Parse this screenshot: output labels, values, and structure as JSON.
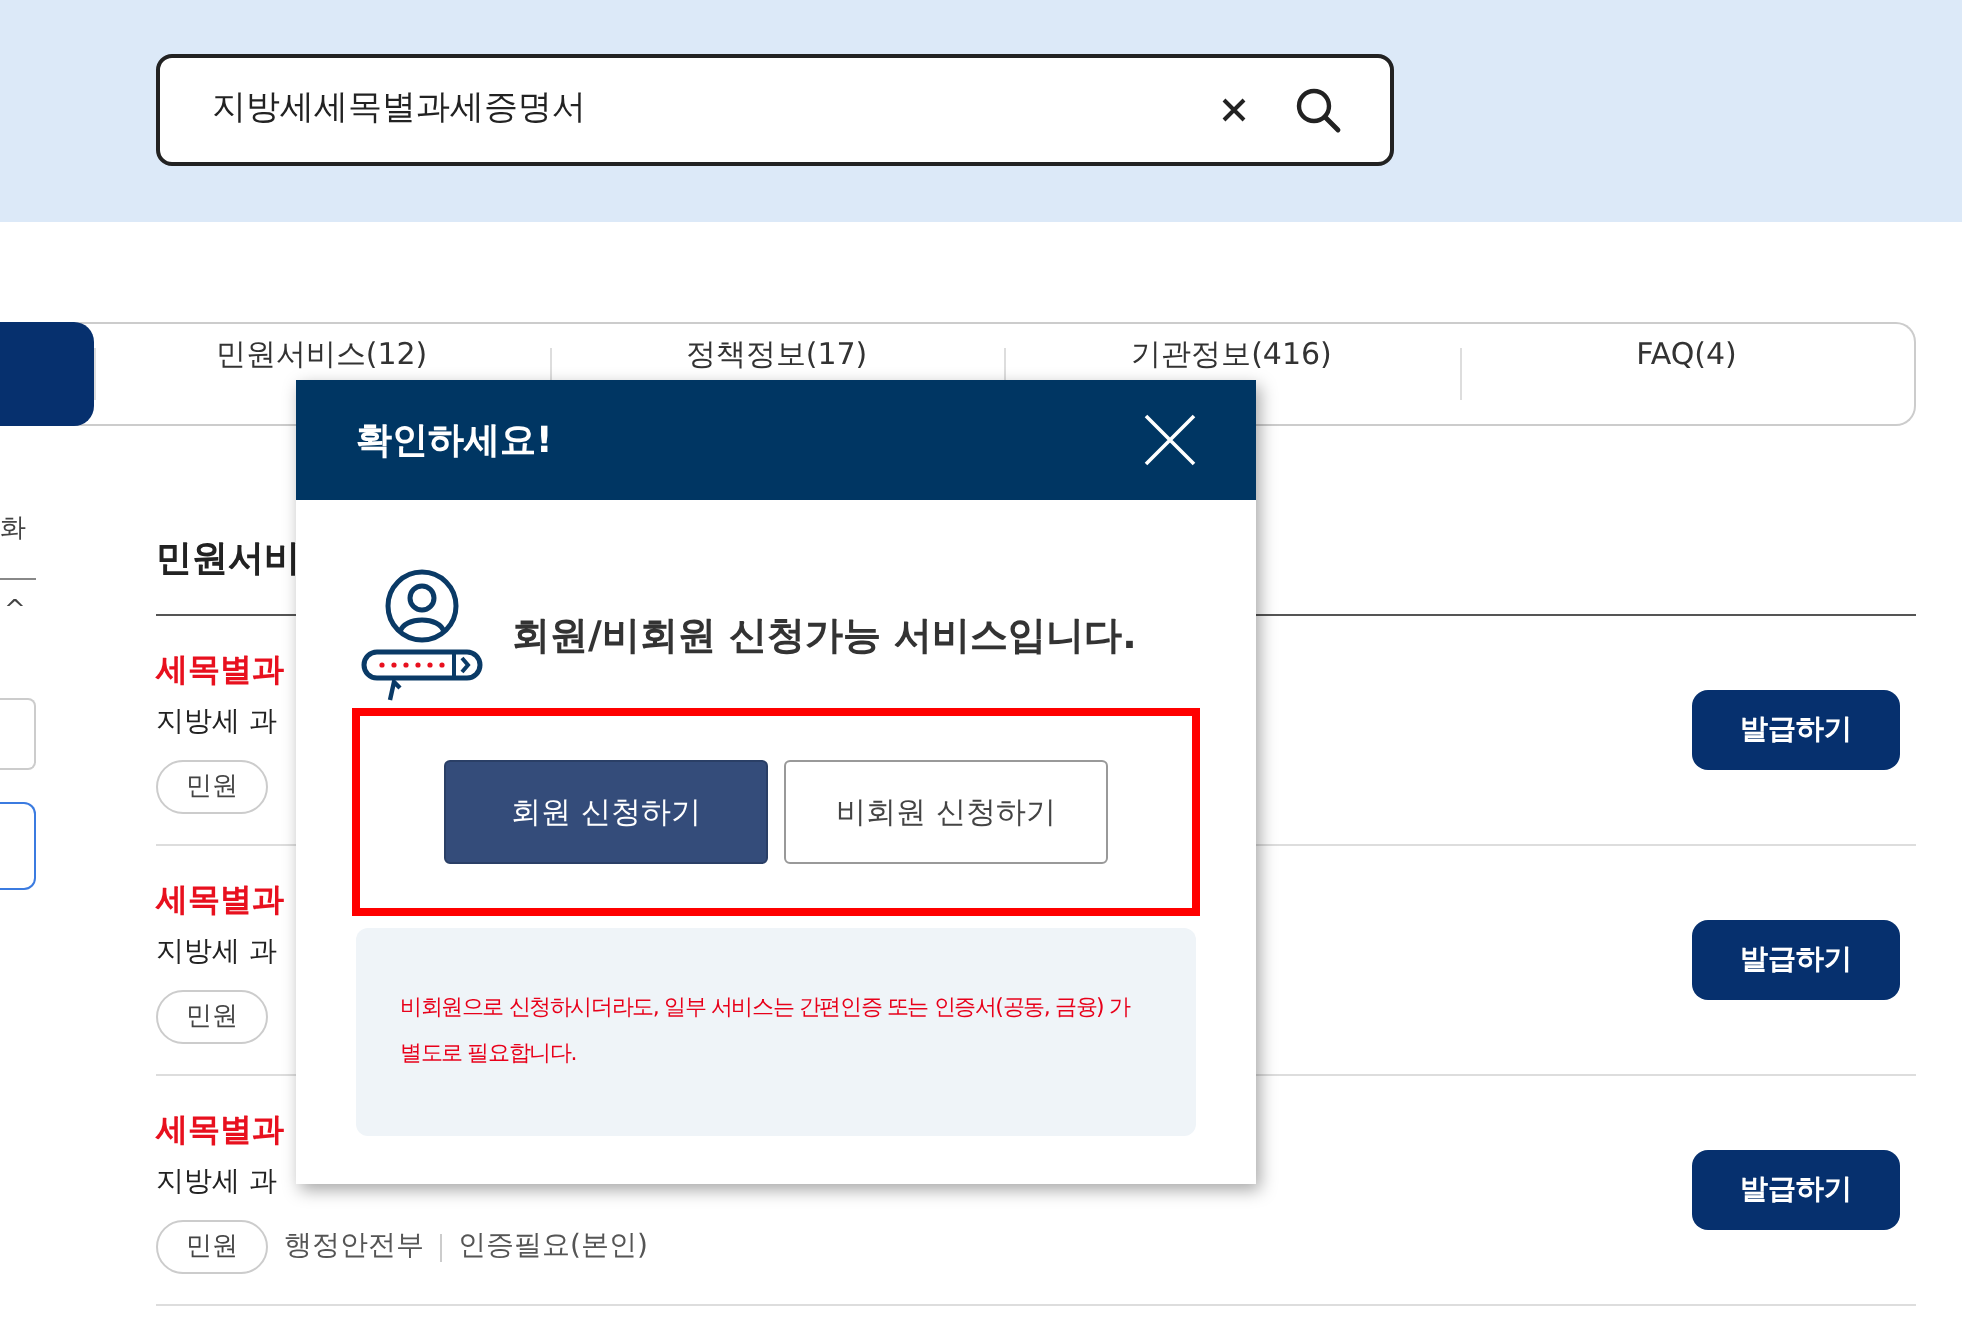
{
  "search": {
    "value": "지방세세목별과세증명서"
  },
  "tabs": [
    {
      "selected": true
    },
    {
      "label": "민원서비스(12)",
      "selected": false
    },
    {
      "label": "정책정보(17)",
      "selected": false
    },
    {
      "label": "기관정보(416)",
      "selected": false
    },
    {
      "label": "FAQ(4)",
      "selected": false
    }
  ],
  "sidebar": {
    "heading": "화",
    "caret": "^"
  },
  "section_title": "민원서비",
  "results": [
    {
      "title": "세목별과",
      "description": "지방세 과",
      "tag": "민원",
      "button": "발급하기"
    },
    {
      "title": "세목별과",
      "description": "지방세 과",
      "tag": "민원",
      "button": "발급하기"
    },
    {
      "title": "세목별과",
      "description": "지방세 과",
      "tag": "민원",
      "agency": "행정안전부",
      "auth": "인증필요(본인)",
      "button": "발급하기"
    }
  ],
  "modal": {
    "title": "확인하세요!",
    "message": "회원/비회원 신청가능 서비스입니다.",
    "buttons": [
      {
        "label": "회원 신청하기",
        "kind": "primary"
      },
      {
        "label": "비회원 신청하기",
        "kind": "outline"
      }
    ],
    "notice": "비회원으로 신청하시더라도, 일부 서비스는 간편인증 또는 인증서(공동, 금융) 가 별도로 필요합니다."
  }
}
